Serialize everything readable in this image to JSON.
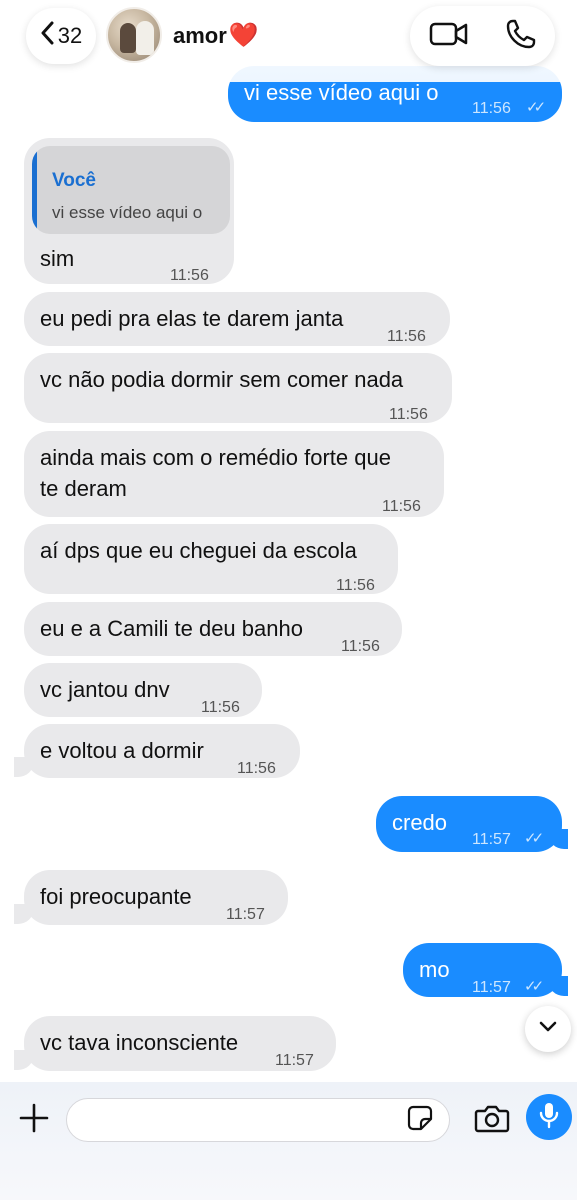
{
  "header": {
    "back_count": "32",
    "contact_name": "amor",
    "contact_emoji": "❤️",
    "icons": [
      "chevron-left-icon",
      "video-camera-icon",
      "phone-icon"
    ]
  },
  "messages": [
    {
      "direction": "out",
      "text": "vi esse vídeo aqui o",
      "time": "11:56",
      "status": "read"
    },
    {
      "direction": "in",
      "reply_to": {
        "author": "Você",
        "text": "vi esse vídeo aqui o"
      },
      "text": "sim",
      "time": "11:56"
    },
    {
      "direction": "in",
      "text": "eu pedi pra elas te darem janta",
      "time": "11:56"
    },
    {
      "direction": "in",
      "text": "vc não podia dormir sem comer nada",
      "time": "11:56"
    },
    {
      "direction": "in",
      "text_lines": [
        "ainda mais com o remédio forte que",
        "te deram"
      ],
      "time": "11:56"
    },
    {
      "direction": "in",
      "text": "aí dps que eu cheguei da escola",
      "time": "11:56"
    },
    {
      "direction": "in",
      "text": "eu e a Camili te deu banho",
      "time": "11:56"
    },
    {
      "direction": "in",
      "text": "vc jantou dnv",
      "time": "11:56"
    },
    {
      "direction": "in",
      "text": "e voltou a dormir",
      "time": "11:56"
    },
    {
      "direction": "out",
      "text": "credo",
      "time": "11:57",
      "status": "read"
    },
    {
      "direction": "in",
      "text": "foi preocupante",
      "time": "11:57"
    },
    {
      "direction": "out",
      "text": "mo",
      "time": "11:57",
      "status": "read"
    },
    {
      "direction": "in",
      "text": "vc tava inconsciente",
      "time": "11:57"
    }
  ],
  "composer": {
    "placeholder": "",
    "value": "",
    "icons": [
      "plus-icon",
      "sticker-icon",
      "camera-icon",
      "microphone-icon"
    ]
  },
  "colors": {
    "outgoing_bubble": "#1a8cff",
    "incoming_bubble": "#e9e9eb",
    "reply_accent": "#1a6fd1",
    "heart": "#e31b2d"
  }
}
